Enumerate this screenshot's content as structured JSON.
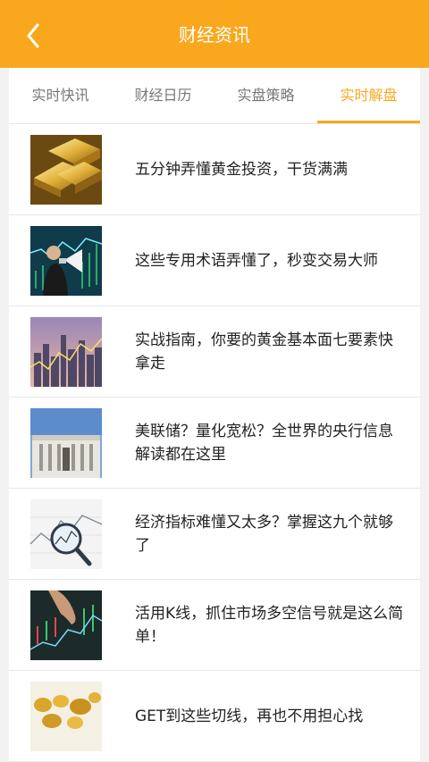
{
  "header": {
    "title": "财经资讯"
  },
  "tabs": [
    {
      "label": "实时快讯"
    },
    {
      "label": "财经日历"
    },
    {
      "label": "实盘策略"
    },
    {
      "label": "实时解盘"
    }
  ],
  "active_tab": 3,
  "articles": [
    {
      "title": "五分钟弄懂黄金投资，干货满满",
      "thumb": "gold-bars-image"
    },
    {
      "title": "这些专用术语弄懂了，秒变交易大师",
      "thumb": "businessman-megaphone-image"
    },
    {
      "title": "实战指南，你要的黄金基本面七要素快拿走",
      "thumb": "city-chart-image"
    },
    {
      "title": "美联储？量化宽松？全世界的央行信息解读都在这里",
      "thumb": "federal-reserve-building-image"
    },
    {
      "title": "经济指标难懂又太多？掌握这九个就够了",
      "thumb": "magnifier-chart-image"
    },
    {
      "title": "活用K线，抓住市场多空信号就是这么简单！",
      "thumb": "touch-chart-image"
    },
    {
      "title": "GET到这些切线，再也不用担心找",
      "thumb": "gold-nuggets-image"
    }
  ],
  "colors": {
    "accent": "#f9a81e",
    "header_text": "#ffffff"
  },
  "icons": {
    "back": "chevron-left-icon"
  }
}
